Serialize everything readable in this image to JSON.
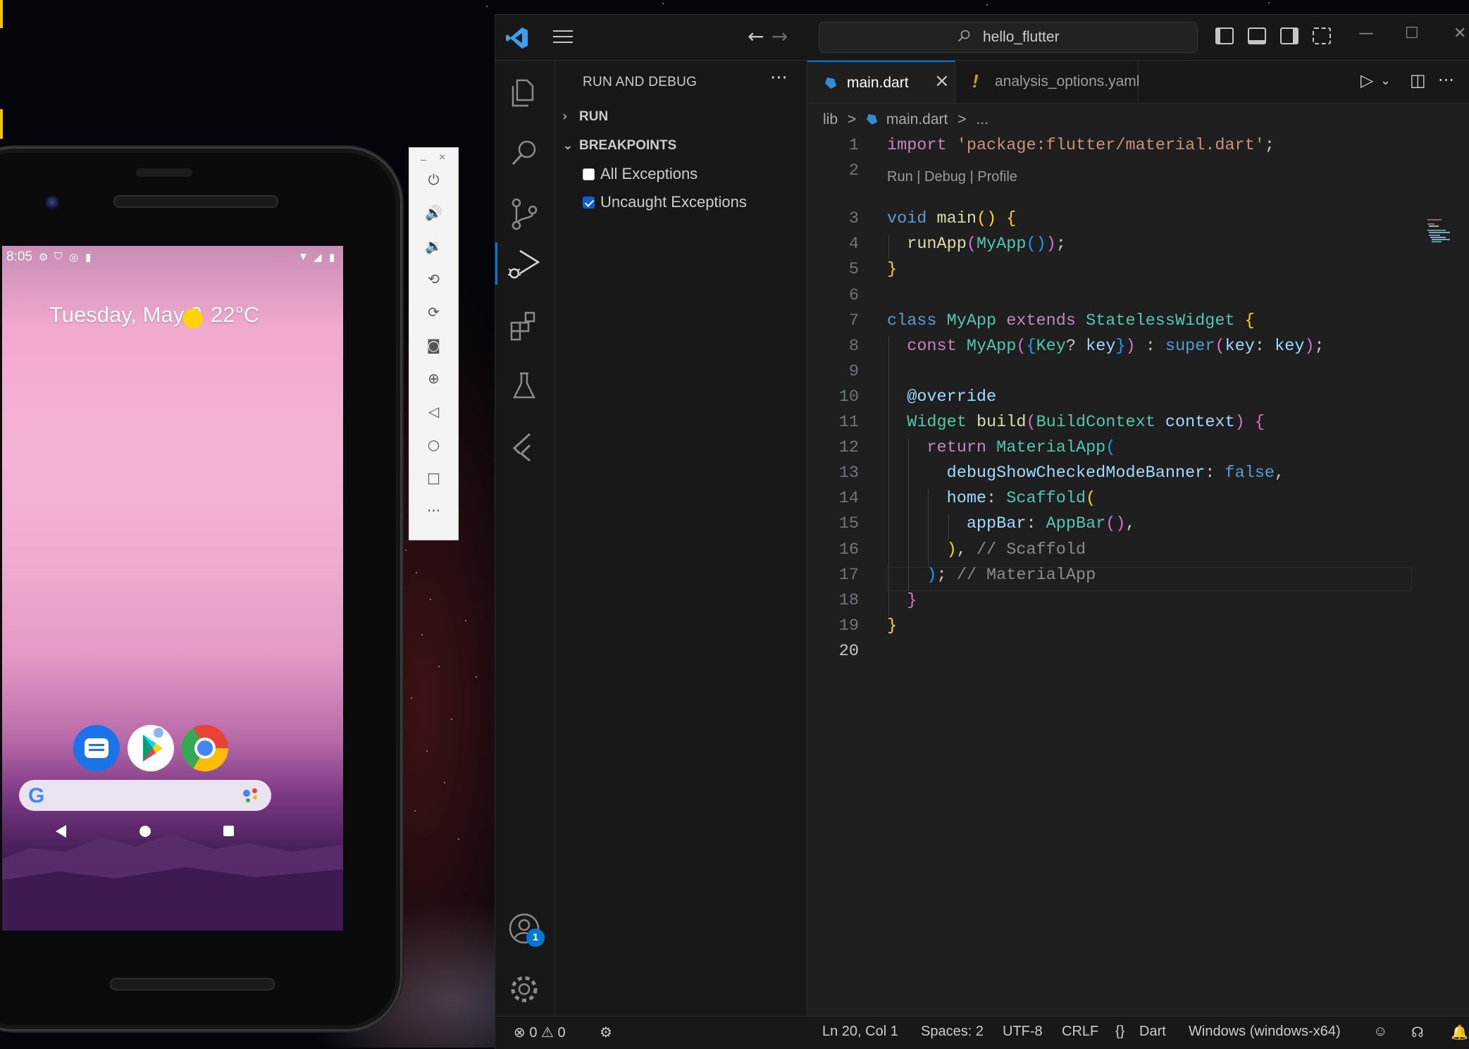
{
  "phone": {
    "status_time": "8:05",
    "date": "Tuesday, May 9",
    "temperature": "22°C",
    "apps": [
      "messages-icon",
      "play-store-icon",
      "chrome-icon"
    ],
    "search_logo": "G"
  },
  "emulator_toolbar": {
    "minimize": "–",
    "close": "×",
    "buttons": [
      "power-icon",
      "volume-up-icon",
      "volume-down-icon",
      "rotate-left-icon",
      "rotate-right-icon",
      "camera-icon",
      "zoom-icon",
      "back-icon",
      "home-icon",
      "overview-icon",
      "more-icon"
    ],
    "more": "···"
  },
  "vscode": {
    "command_center": "hello_flutter",
    "sidebar": {
      "title": "RUN AND DEBUG",
      "more": "···",
      "sections": [
        {
          "label": "RUN",
          "expanded": false
        },
        {
          "label": "BREAKPOINTS",
          "expanded": true
        }
      ],
      "breakpoints": [
        {
          "label": "All Exceptions",
          "checked": false
        },
        {
          "label": "Uncaught Exceptions",
          "checked": true
        }
      ]
    },
    "tabs": [
      {
        "label": "main.dart",
        "active": true,
        "close": "×"
      },
      {
        "label": "analysis_options.yaml",
        "active": false,
        "marker": "!"
      }
    ],
    "breadcrumb": [
      "lib",
      ">",
      "main.dart",
      ">",
      "..."
    ],
    "codelens": "Run | Debug | Profile",
    "line_numbers": [
      "1",
      "2",
      "3",
      "4",
      "5",
      "6",
      "7",
      "8",
      "9",
      "10",
      "11",
      "12",
      "13",
      "14",
      "15",
      "16",
      "17",
      "18",
      "19",
      "20"
    ],
    "current_line": "20",
    "code_lines": [
      "import 'package:flutter/material.dart';",
      "",
      "void main() {",
      "  runApp(MyApp());",
      "}",
      "",
      "class MyApp extends StatelessWidget {",
      "  const MyApp({Key? key}) : super(key: key);",
      "",
      "  @override",
      "  Widget build(BuildContext context) {",
      "    return MaterialApp(",
      "      debugShowCheckedModeBanner: false,",
      "      home: Scaffold(",
      "        appBar: AppBar(),",
      "      ), // Scaffold",
      "    ); // MaterialApp",
      "  }",
      "}",
      ""
    ],
    "statusbar": {
      "errors": "0",
      "warnings": "0",
      "position": "Ln 20, Col 1",
      "spaces": "Spaces: 2",
      "encoding": "UTF-8",
      "eol": "CRLF",
      "language_icon": "{}",
      "language": "Dart",
      "device": "Windows (windows-x64)"
    },
    "accounts_badge": "1"
  },
  "colors": {
    "accent": "#0078d4",
    "editor_bg": "#1f1f1f",
    "chrome_bg": "#181818"
  }
}
